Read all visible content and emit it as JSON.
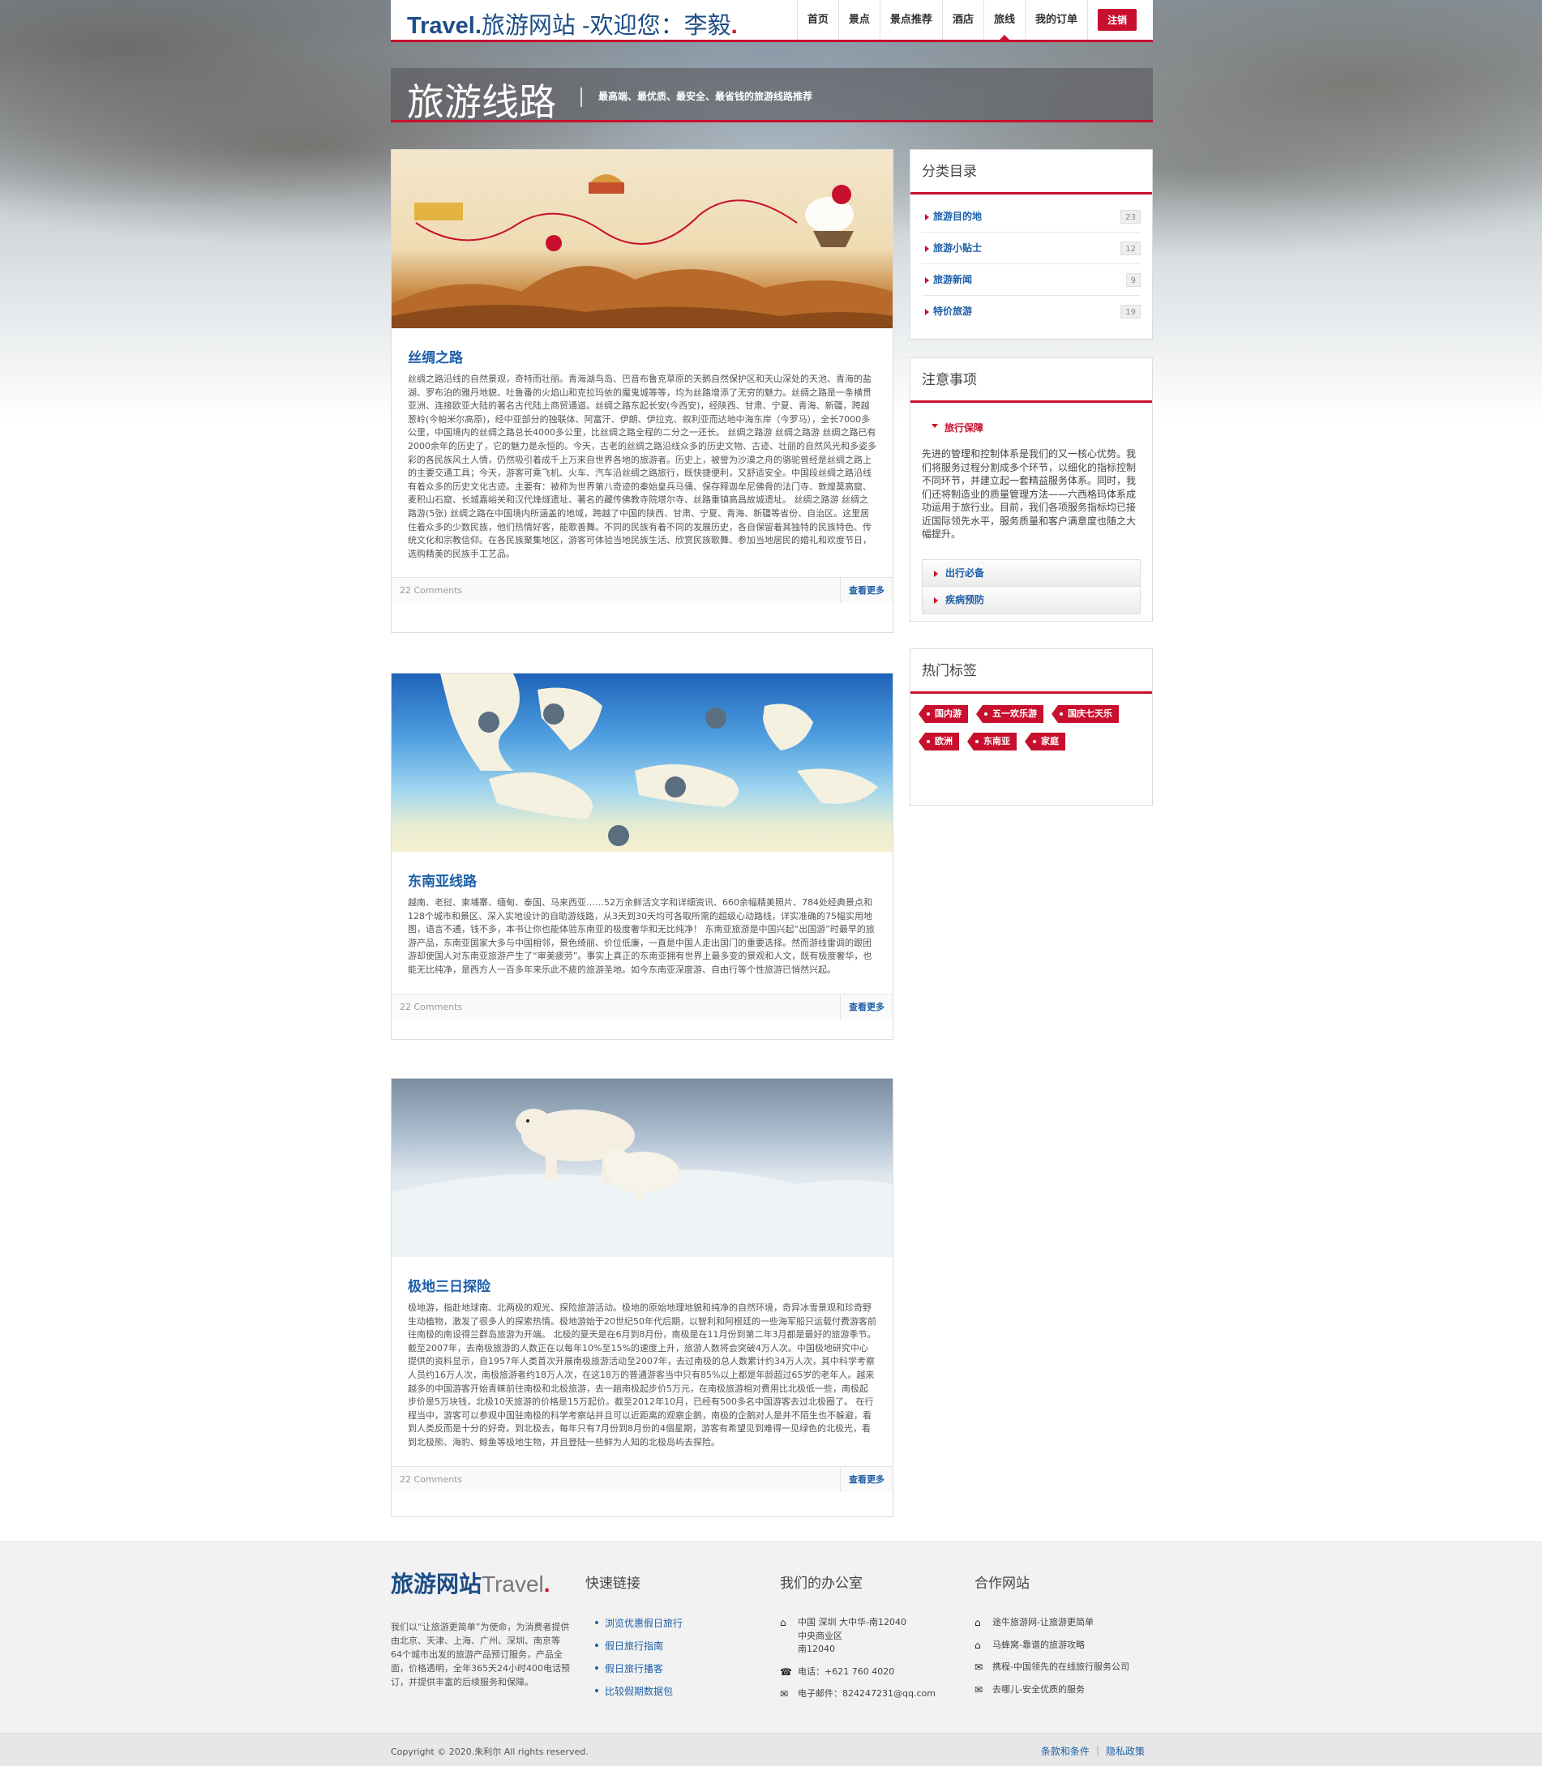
{
  "header": {
    "logo_prefix": "Travel.",
    "logo_text": "旅游网站 -欢迎您：李毅",
    "nav": [
      "首页",
      "景点",
      "景点推荐",
      "酒店",
      "旅线",
      "我的订单"
    ],
    "logout": "注销"
  },
  "banner": {
    "title": "旅游线路",
    "subtitle": "最高端、最优质、最安全、最省钱的旅游线路推荐"
  },
  "posts": [
    {
      "title": "丝绸之路",
      "body": "丝绸之路沿线的自然景观，奇特而壮丽。青海湖鸟岛、巴音布鲁克草原的天鹅自然保护区和天山深处的天池、青海的盐湖、罗布泊的雅丹地貌、吐鲁番的火焰山和克拉玛依的魔鬼城等等，均为丝路增添了无穷的魅力。丝绸之路是一条横贯亚洲、连接欧亚大陆的著名古代陆上商贸通道。丝绸之路东起长安(今西安)，经陕西、甘肃、宁夏、青海、新疆，跨越葱岭(今帕米尔高原)，经中亚部分的独联体、阿富汗、伊朗、伊拉克、叙利亚而达地中海东岸（今罗马），全长7000多公里，中国境内的丝绸之路总长4000多公里，比丝绸之路全程的二分之一还长。 丝绸之路游 丝绸之路游 丝绸之路已有2000余年的历史了，它的魅力是永恒的。今天，古老的丝绸之路沿线众多的历史文物、古迹、壮丽的自然风光和多姿多彩的各民族风土人情，仍然吸引着成千上万来自世界各地的旅游者。历史上，被誉为沙漠之舟的骆驼曾经是丝绸之路上的主要交通工具；今天，游客可乘飞机、火车、汽车沿丝绸之路旅行，既快捷便利，又舒适安全。中国段丝绸之路沿线有着众多的历史文化古迹。主要有：被称为世界第八奇迹的秦始皇兵马俑、保存释迦牟尼佛骨的法门寺、敦煌莫高窟、麦积山石窟、长城嘉峪关和汉代烽燧遗址、著名的藏传佛教寺院塔尔寺、丝路重镇高昌故城遗址。 丝绸之路游 丝绸之路游(5张) 丝绸之路在中国境内所涵盖的地域，跨越了中国的陕西、甘肃、宁夏、青海、新疆等省份、自治区。这里居住着众多的少数民族，他们热情好客，能歌善舞。不同的民族有着不同的发展历史，各自保留着其独特的民族特色、传统文化和宗教信仰。在各民族聚集地区，游客可体验当地民族生活、欣赏民族歌舞、参加当地居民的婚礼和欢度节日，选购精美的民族手工艺品。",
      "comments": "22 Comments",
      "more": "查看更多"
    },
    {
      "title": "东南亚线路",
      "body": "越南、老挝、柬埔寨、缅甸、泰国、马来西亚……52万余鲜活文字和详细资讯、660余幅精美照片、784处经典景点和128个城市和景区、深入实地设计的自助游线路，从3天到30天均可各取所需的超级心动路线，详实准确的75幅实用地图，语言不通，钱不多，本书让你也能体验东南亚的极度奢华和无比纯净！ 东南亚旅游是中国兴起“出国游”时最早的旅游产品，东南亚国家大多与中国相邻，景色绮丽、价位低廉，一直是中国人走出国门的重要选择。然而游线雷调的跟团游却使国人对东南亚旅游产生了“审美疲劳”。事实上真正的东南亚拥有世界上最多变的景观和人文，既有极度奢华，也能无比纯净，是西方人一百多年来乐此不疲的旅游圣地。如今东南亚深度游、自由行等个性旅游已悄然兴起。",
      "comments": "22 Comments",
      "more": "查看更多"
    },
    {
      "title": "极地三日探险",
      "body": "极地游，指赴地球南、北两极的观光、探险旅游活动。极地的原始地理地貌和纯净的自然环境，奇异冰雪景观和珍奇野生动植物，激发了很多人的探索热情。极地游始于20世纪50年代后期，以智利和阿根廷的一些海军船只运载付费游客前往南极的南设得兰群岛旅游为开端。 北极的夏天是在6月到8月份，南极是在11月份到第二年3月都是最好的旅游季节。截至2007年，去南极旅游的人数正在以每年10%至15%的速度上升，旅游人数将会突破4万人次。中国极地研究中心提供的资料显示，自1957年人类首次开展南极旅游活动至2007年，去过南极的总人数累计约34万人次，其中科学考察人员约16万人次，南极旅游者约18万人次，在这18万的普通游客当中只有85%以上都是年龄超过65岁的老年人。越来越多的中国游客开始青睐前往南极和北极旅游，去一趟南极起步价5万元，在南极旅游相对费用比北极低一些，南极起步价是5万块钱，北极10天旅游的价格是15万起价。截至2012年10月，已经有500多名中国游客去过北极圈了。 在行程当中，游客可以参观中国驻南极的科学考察站并且可以近距离的观察企鹅，南极的企鹅对人是并不陌生也不躲避，看到人类反而是十分的好奇。到北极去，每年只有7月份到8月份的4個星期，游客有希望见到难得一见绿色的北极光，看到北极熊、海豹、鲸鱼等极地生物，并且登陆一些鲜为人知的北极岛屿去探险。",
      "comments": "22 Comments",
      "more": "查看更多"
    }
  ],
  "sidebar": {
    "categories": {
      "title": "分类目录",
      "items": [
        {
          "label": "旅游目的地",
          "count": "23"
        },
        {
          "label": "旅游小贴士",
          "count": "12"
        },
        {
          "label": "旅游新闻",
          "count": "9"
        },
        {
          "label": "特价旅游",
          "count": "19"
        }
      ]
    },
    "notice": {
      "title": "注意事项",
      "section_title": "旅行保障",
      "text": "先进的管理和控制体系是我们的又一核心优势。我们将服务过程分割成多个环节，以细化的指标控制不同环节，并建立起一套精益服务体系。同时，我们还将制造业的质量管理方法——六西格玛体系成功运用于旅行业。目前，我们各项服务指标均已接近国际领先水平，服务质量和客户满意度也随之大幅提升。",
      "links": [
        "出行必备",
        "疾病预防"
      ]
    },
    "tags": {
      "title": "热门标签",
      "items": [
        "国内游",
        "五一欢乐游",
        "国庆七天乐",
        "欧洲",
        "东南亚",
        "家庭"
      ]
    }
  },
  "footer": {
    "logo_cn": "旅游网站",
    "logo_en": "Travel",
    "about": "我们以“让旅游更简单”为使命，为消费者提供由北京、天津、上海、广州、深圳、南京等64个城市出发的旅游产品预订服务，产品全面，价格透明，全年365天24小时400电话预订，并提供丰富的后续服务和保障。",
    "quick_title": "快速链接",
    "quick_links": [
      "浏览优惠假日旅行",
      "假日旅行指南",
      "假日旅行播客",
      "比较假期数据包"
    ],
    "office_title": "我们的办公室",
    "office_address": "中国 深圳 大中华-南12040\n中央商业区\n南12040",
    "office_phone": "电话：+621 760 4020",
    "office_email": "电子邮件：824247231@qq.com",
    "partners_title": "合作网站",
    "partners": [
      "途牛旅游网-让旅游更简单",
      "马蜂窝-靠谱的旅游攻略",
      "携程-中国领先的在线旅行服务公司",
      "去哪儿-安全优质的服务"
    ],
    "copyright": "Copyright © 2020.朱利尔 All rights reserved.",
    "terms": "条款和条件",
    "privacy": "隐私政策"
  }
}
